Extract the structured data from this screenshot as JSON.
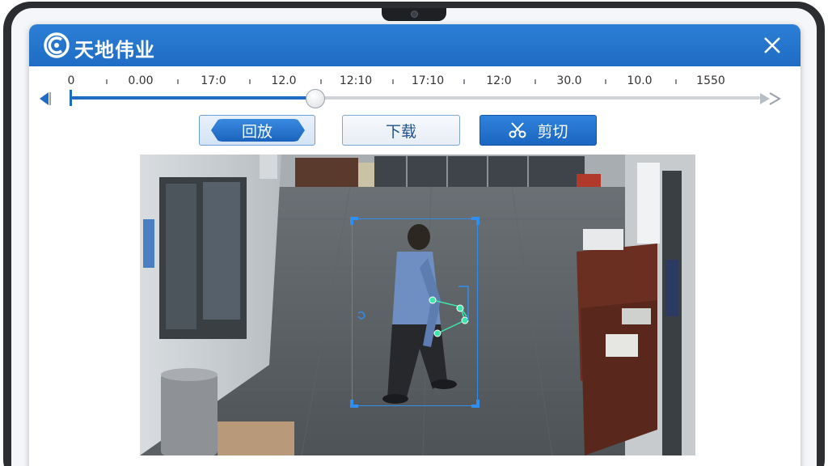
{
  "app": {
    "title": "天地伟业"
  },
  "timeline": {
    "ticks": [
      "0",
      "0.00",
      "17:0",
      "12.0",
      "12:10",
      "17:10",
      "12:0",
      "30.0",
      "10.0",
      "1550"
    ],
    "progress_fraction": 0.355
  },
  "toolbar": {
    "replay_label": "回放",
    "download_label": "下载",
    "cut_label": "剪切"
  },
  "colors": {
    "brand_blue": "#1f6cc4",
    "detect_box": "#2f8ef0",
    "keypoint": "#3ee6a8"
  },
  "icons": {
    "logo": "tiandy-logo-icon",
    "close": "close-icon",
    "scissors": "scissors-icon",
    "prev": "arrow-left-icon",
    "next": "arrow-right-icon"
  }
}
